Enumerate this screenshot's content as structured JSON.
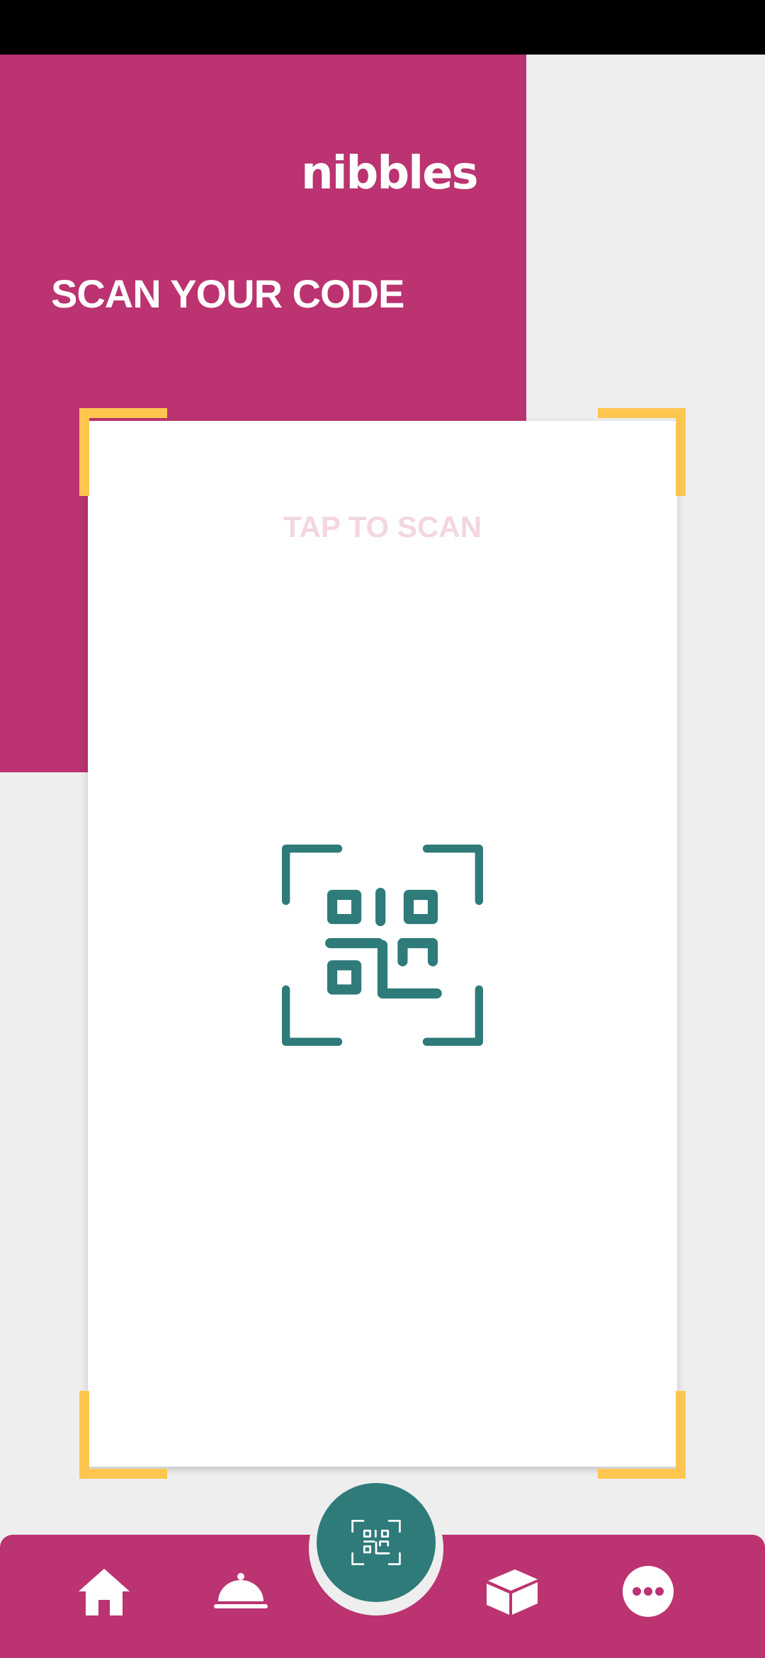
{
  "header": {
    "logo_text": "nibbles",
    "title": "SCAN YOUR CODE"
  },
  "scanner": {
    "tap_label": "TAP TO SCAN",
    "icon": "qr-code-scan-icon"
  },
  "bottom_nav": {
    "items": [
      {
        "icon": "home-icon"
      },
      {
        "icon": "food-cloche-icon"
      },
      {
        "icon": "qr-code-scan-icon"
      },
      {
        "icon": "box-icon"
      },
      {
        "icon": "more-icon"
      }
    ]
  },
  "colors": {
    "brand": "#bb3370",
    "accent": "#2e7b7a",
    "frame": "#ffc64f",
    "background": "#eeeeee"
  }
}
